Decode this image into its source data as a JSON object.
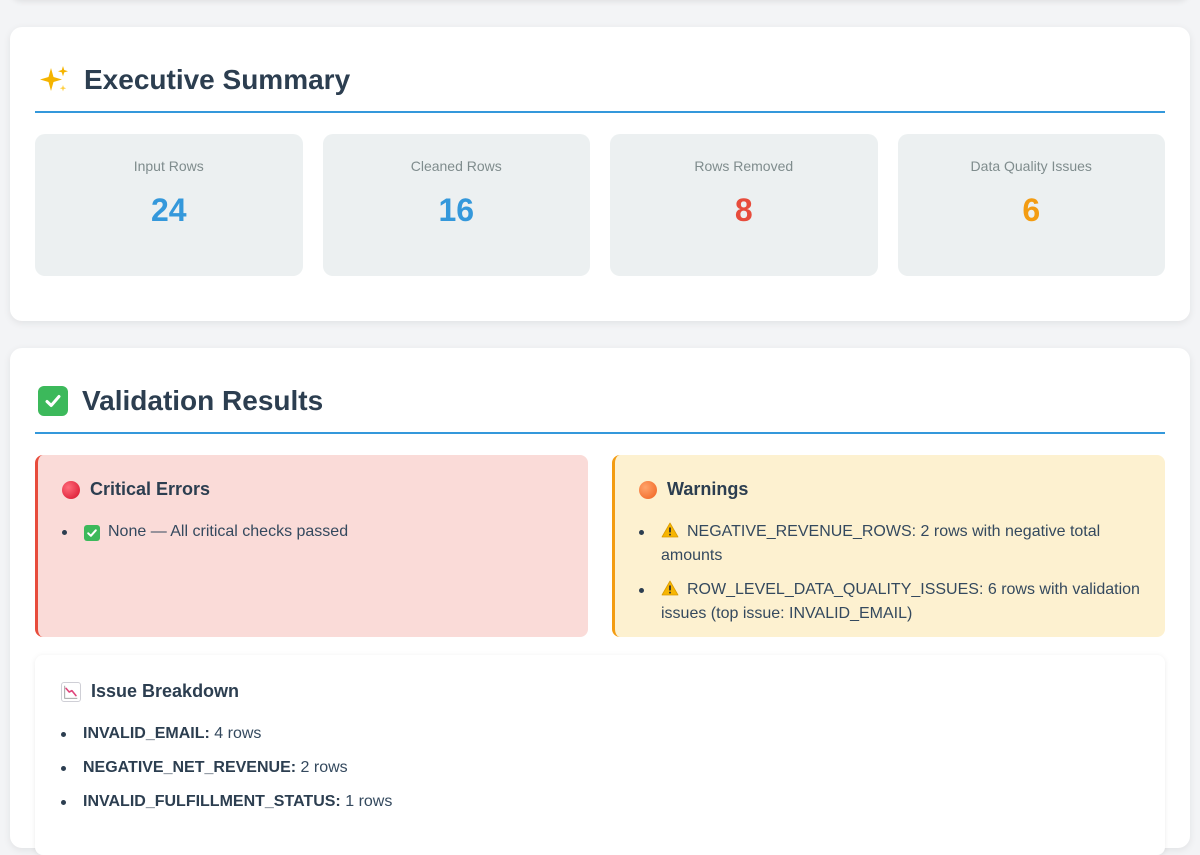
{
  "summary": {
    "title": "Executive Summary",
    "stats": [
      {
        "label": "Input Rows",
        "value": "24",
        "color": "#3498db"
      },
      {
        "label": "Cleaned Rows",
        "value": "16",
        "color": "#3498db"
      },
      {
        "label": "Rows Removed",
        "value": "8",
        "color": "#e74c3c"
      },
      {
        "label": "Data Quality Issues",
        "value": "6",
        "color": "#f39c12"
      }
    ]
  },
  "validation": {
    "title": "Validation Results",
    "critical": {
      "title": "Critical Errors",
      "items": [
        "None — All critical checks passed"
      ]
    },
    "warnings": {
      "title": "Warnings",
      "items": [
        "NEGATIVE_REVENUE_ROWS: 2 rows with negative total amounts",
        "ROW_LEVEL_DATA_QUALITY_ISSUES: 6 rows with validation issues (top issue: INVALID_EMAIL)"
      ]
    },
    "breakdown": {
      "title": "Issue Breakdown",
      "items": [
        {
          "key": "INVALID_EMAIL:",
          "value": "4 rows"
        },
        {
          "key": "NEGATIVE_NET_REVENUE:",
          "value": "2 rows"
        },
        {
          "key": "INVALID_FULFILLMENT_STATUS:",
          "value": "1 rows"
        }
      ]
    }
  },
  "icons": {
    "summary": "sparkles-icon",
    "validation": "check-mark-button-icon",
    "critical": "red-circle-icon",
    "warnings": "orange-circle-icon",
    "warning_item": "warning-icon",
    "breakdown": "chart-decreasing-icon"
  }
}
